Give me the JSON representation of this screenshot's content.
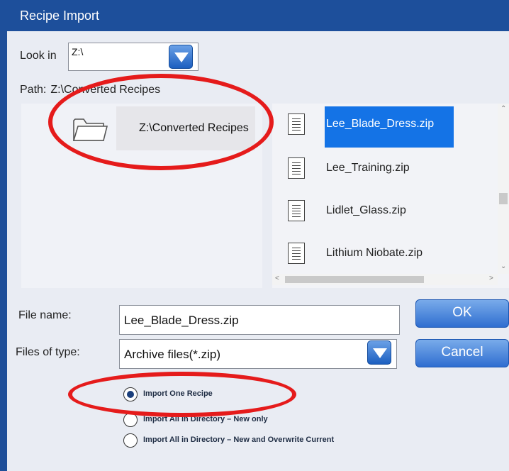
{
  "window": {
    "title": "Recipe Import"
  },
  "look_in": {
    "label": "Look in",
    "value": "Z:\\"
  },
  "path": {
    "label": "Path:",
    "value": "Z:\\Converted Recipes"
  },
  "folder_pane": {
    "items": [
      {
        "label": "Z:\\Converted Recipes",
        "icon": "folder-icon"
      }
    ]
  },
  "file_list": {
    "items": [
      {
        "name": "Lee_Blade_Dress.zip",
        "selected": true
      },
      {
        "name": "Lee_Training.zip",
        "selected": false
      },
      {
        "name": "Lidlet_Glass.zip",
        "selected": false
      },
      {
        "name": "Lithium Niobate.zip",
        "selected": false
      }
    ]
  },
  "file_name": {
    "label": "File name:",
    "value": "Lee_Blade_Dress.zip"
  },
  "files_of_type": {
    "label": "Files of type:",
    "value": "Archive files(*.zip)"
  },
  "buttons": {
    "ok": "OK",
    "cancel": "Cancel"
  },
  "radio_options": [
    {
      "label": "Import One Recipe",
      "checked": true
    },
    {
      "label": "Import All in Directory – New only",
      "checked": false
    },
    {
      "label": "Import All in Directory – New and Overwrite Current",
      "checked": false
    }
  ],
  "colors": {
    "title_bar": "#1d4f9b",
    "selection": "#1473e6",
    "annotation": "#e51b1b",
    "button": "#2f6ed0"
  }
}
